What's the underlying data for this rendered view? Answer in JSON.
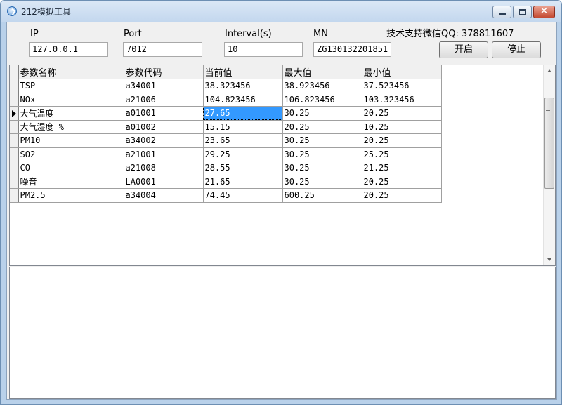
{
  "window": {
    "title": "212模拟工具"
  },
  "header": {
    "support_text": "技术支持微信QQ: 378811607",
    "fields": {
      "ip": {
        "label": "IP",
        "value": "127.0.0.1"
      },
      "port": {
        "label": "Port",
        "value": "7012"
      },
      "interval": {
        "label": "Interval(s)",
        "value": "10"
      },
      "mn": {
        "label": "MN",
        "value": "ZG130132201851"
      }
    },
    "buttons": {
      "start": "开启",
      "stop": "停止"
    }
  },
  "grid": {
    "columns": [
      "参数名称",
      "参数代码",
      "当前值",
      "最大值",
      "最小值"
    ],
    "selected_row": 2,
    "rows": [
      [
        "TSP",
        "a34001",
        "38.323456",
        "38.923456",
        "37.523456"
      ],
      [
        "NOx",
        "a21006",
        "104.823456",
        "106.823456",
        "103.323456"
      ],
      [
        "大气温度",
        "a01001",
        "27.65",
        "30.25",
        "20.25"
      ],
      [
        "大气湿度 %",
        "a01002",
        "15.15",
        "20.25",
        "10.25"
      ],
      [
        "PM10",
        "a34002",
        "23.65",
        "30.25",
        "20.25"
      ],
      [
        "SO2",
        "a21001",
        "29.25",
        "30.25",
        "25.25"
      ],
      [
        "CO",
        "a21008",
        "28.55",
        "30.25",
        "21.25"
      ],
      [
        "噪音",
        "LA0001",
        "21.65",
        "30.25",
        "20.25"
      ],
      [
        "PM2.5",
        "a34004",
        "74.45",
        "600.25",
        "20.25"
      ]
    ]
  }
}
